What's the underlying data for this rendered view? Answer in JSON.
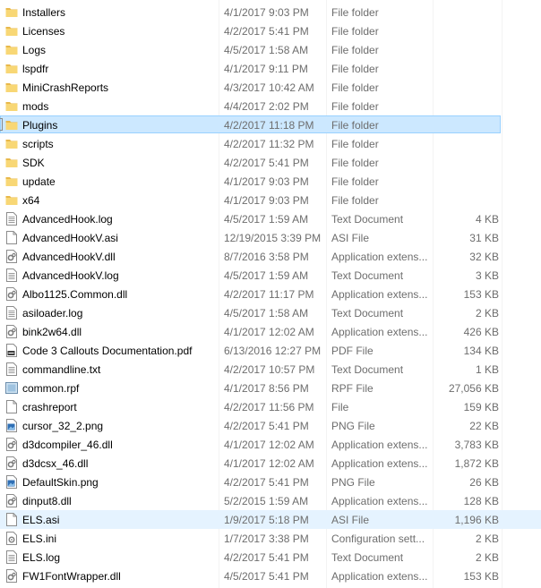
{
  "files": [
    {
      "name": "Installers",
      "date": "4/1/2017 9:03 PM",
      "type": "File folder",
      "size": "",
      "icon": "folder-icon"
    },
    {
      "name": "Licenses",
      "date": "4/2/2017 5:41 PM",
      "type": "File folder",
      "size": "",
      "icon": "folder-icon"
    },
    {
      "name": "Logs",
      "date": "4/5/2017 1:58 AM",
      "type": "File folder",
      "size": "",
      "icon": "folder-icon"
    },
    {
      "name": "lspdfr",
      "date": "4/1/2017 9:11 PM",
      "type": "File folder",
      "size": "",
      "icon": "folder-icon"
    },
    {
      "name": "MiniCrashReports",
      "date": "4/3/2017 10:42 AM",
      "type": "File folder",
      "size": "",
      "icon": "folder-icon"
    },
    {
      "name": "mods",
      "date": "4/4/2017 2:02 PM",
      "type": "File folder",
      "size": "",
      "icon": "folder-icon"
    },
    {
      "name": "Plugins",
      "date": "4/2/2017 11:18 PM",
      "type": "File folder",
      "size": "",
      "icon": "folder-icon",
      "state": "selected"
    },
    {
      "name": "scripts",
      "date": "4/2/2017 11:32 PM",
      "type": "File folder",
      "size": "",
      "icon": "folder-icon"
    },
    {
      "name": "SDK",
      "date": "4/2/2017 5:41 PM",
      "type": "File folder",
      "size": "",
      "icon": "folder-icon"
    },
    {
      "name": "update",
      "date": "4/1/2017 9:03 PM",
      "type": "File folder",
      "size": "",
      "icon": "folder-icon"
    },
    {
      "name": "x64",
      "date": "4/1/2017 9:03 PM",
      "type": "File folder",
      "size": "",
      "icon": "folder-icon"
    },
    {
      "name": "AdvancedHook.log",
      "date": "4/5/2017 1:59 AM",
      "type": "Text Document",
      "size": "4 KB",
      "icon": "text-document-icon"
    },
    {
      "name": "AdvancedHookV.asi",
      "date": "12/19/2015 3:39 PM",
      "type": "ASI File",
      "size": "31 KB",
      "icon": "blank-file-icon"
    },
    {
      "name": "AdvancedHookV.dll",
      "date": "8/7/2016 3:58 PM",
      "type": "Application extens...",
      "size": "32 KB",
      "icon": "dll-file-icon"
    },
    {
      "name": "AdvancedHookV.log",
      "date": "4/5/2017 1:59 AM",
      "type": "Text Document",
      "size": "3 KB",
      "icon": "text-document-icon"
    },
    {
      "name": "Albo1125.Common.dll",
      "date": "4/2/2017 11:17 PM",
      "type": "Application extens...",
      "size": "153 KB",
      "icon": "dll-file-icon"
    },
    {
      "name": "asiloader.log",
      "date": "4/5/2017 1:58 AM",
      "type": "Text Document",
      "size": "2 KB",
      "icon": "text-document-icon"
    },
    {
      "name": "bink2w64.dll",
      "date": "4/1/2017 12:02 AM",
      "type": "Application extens...",
      "size": "426 KB",
      "icon": "dll-file-icon"
    },
    {
      "name": "Code 3 Callouts Documentation.pdf",
      "date": "6/13/2016 12:27 PM",
      "type": "PDF File",
      "size": "134 KB",
      "icon": "pdf-file-icon"
    },
    {
      "name": "commandline.txt",
      "date": "4/2/2017 10:57 PM",
      "type": "Text Document",
      "size": "1 KB",
      "icon": "text-document-icon"
    },
    {
      "name": "common.rpf",
      "date": "4/1/2017 8:56 PM",
      "type": "RPF File",
      "size": "27,056 KB",
      "icon": "rpf-file-icon"
    },
    {
      "name": "crashreport",
      "date": "4/2/2017 11:56 PM",
      "type": "File",
      "size": "159 KB",
      "icon": "blank-file-icon"
    },
    {
      "name": "cursor_32_2.png",
      "date": "4/2/2017 5:41 PM",
      "type": "PNG File",
      "size": "22 KB",
      "icon": "image-file-icon"
    },
    {
      "name": "d3dcompiler_46.dll",
      "date": "4/1/2017 12:02 AM",
      "type": "Application extens...",
      "size": "3,783 KB",
      "icon": "dll-file-icon"
    },
    {
      "name": "d3dcsx_46.dll",
      "date": "4/1/2017 12:02 AM",
      "type": "Application extens...",
      "size": "1,872 KB",
      "icon": "dll-file-icon"
    },
    {
      "name": "DefaultSkin.png",
      "date": "4/2/2017 5:41 PM",
      "type": "PNG File",
      "size": "26 KB",
      "icon": "image-file-icon"
    },
    {
      "name": "dinput8.dll",
      "date": "5/2/2015 1:59 AM",
      "type": "Application extens...",
      "size": "128 KB",
      "icon": "dll-file-icon"
    },
    {
      "name": "ELS.asi",
      "date": "1/9/2017 5:18 PM",
      "type": "ASI File",
      "size": "1,196 KB",
      "icon": "blank-file-icon",
      "state": "hover"
    },
    {
      "name": "ELS.ini",
      "date": "1/7/2017 3:38 PM",
      "type": "Configuration sett...",
      "size": "2 KB",
      "icon": "config-file-icon"
    },
    {
      "name": "ELS.log",
      "date": "4/2/2017 5:41 PM",
      "type": "Text Document",
      "size": "2 KB",
      "icon": "text-document-icon"
    },
    {
      "name": "FW1FontWrapper.dll",
      "date": "4/5/2017 5:41 PM",
      "type": "Application extens...",
      "size": "153 KB",
      "icon": "dll-file-icon"
    }
  ],
  "colors": {
    "selected_bg": "#cce8ff",
    "selected_border": "#99d1ff",
    "hover_bg": "#e5f3ff",
    "folder": "#f8d775",
    "secondary_text": "#6d6d6d"
  }
}
